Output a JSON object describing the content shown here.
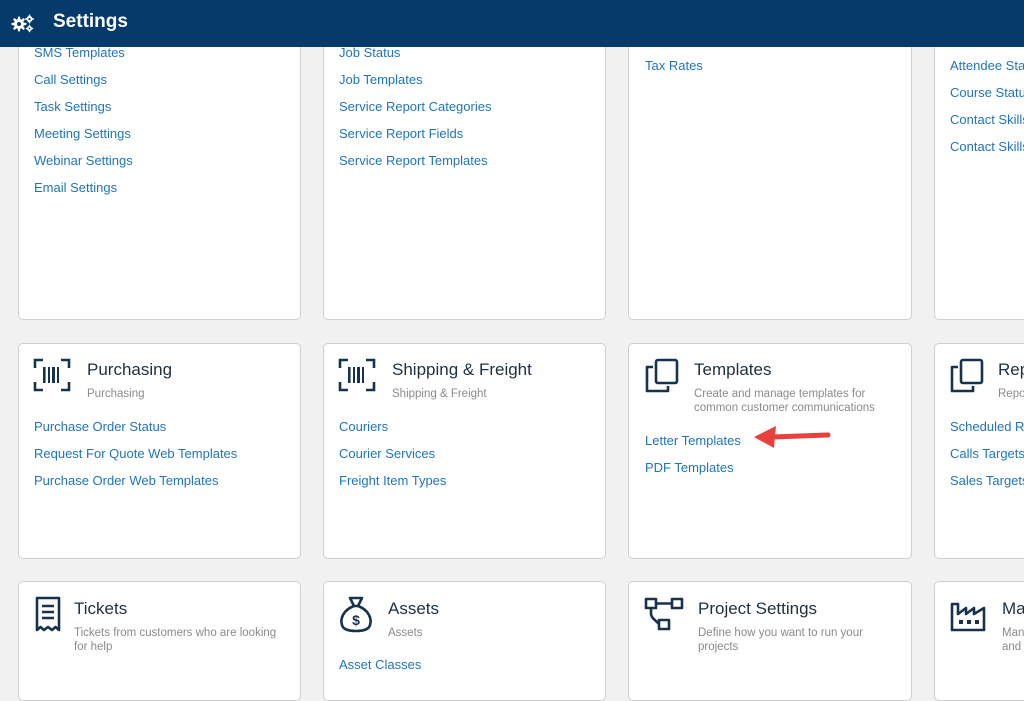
{
  "header": {
    "title": "Settings",
    "icon": "gears-icon"
  },
  "colors": {
    "header_bg": "#063a6b",
    "link": "#1f74bf",
    "arrow": "#e8413c"
  },
  "row1": {
    "col1": {
      "links": [
        "SMS Templates",
        "Call Settings",
        "Task Settings",
        "Meeting Settings",
        "Webinar Settings",
        "Email Settings"
      ]
    },
    "col2": {
      "links": [
        "Job Status",
        "Job Templates",
        "Service Report Categories",
        "Service Report Fields",
        "Service Report Templates"
      ]
    },
    "col3": {
      "links": [
        "Tax Rates"
      ]
    },
    "col4": {
      "links": [
        "Attendee Sta",
        "Course Statu",
        "Contact Skills",
        "Contact Skills"
      ]
    }
  },
  "row2": {
    "purchasing": {
      "title": "Purchasing",
      "subtitle": "Purchasing",
      "icon": "barcode-icon",
      "links": [
        "Purchase Order Status",
        "Request For Quote Web Templates",
        "Purchase Order Web Templates"
      ]
    },
    "shipping": {
      "title": "Shipping & Freight",
      "subtitle": "Shipping & Freight",
      "icon": "barcode-icon",
      "links": [
        "Couriers",
        "Courier Services",
        "Freight Item Types"
      ]
    },
    "templates": {
      "title": "Templates",
      "subtitle_line1": "Create and manage templates for",
      "subtitle_line2": "common customer communications",
      "icon": "copy-icon",
      "links": [
        "Letter Templates",
        "PDF Templates"
      ]
    },
    "reports": {
      "title": "Rep",
      "subtitle": "Repo",
      "icon": "copy-icon",
      "links": [
        "Scheduled Re",
        "Calls Targets",
        "Sales Targets"
      ]
    }
  },
  "row3": {
    "tickets": {
      "title": "Tickets",
      "subtitle_line1": "Tickets from customers who are looking",
      "subtitle_line2": "for help",
      "icon": "receipt-icon"
    },
    "assets": {
      "title": "Assets",
      "subtitle": "Assets",
      "icon": "money-bag-icon",
      "links": [
        "Asset Classes"
      ]
    },
    "project_settings": {
      "title": "Project Settings",
      "subtitle_line1": "Define how you want to run your",
      "subtitle_line2": "projects",
      "icon": "flowchart-icon"
    },
    "manufacturing": {
      "title": "Ma",
      "subtitle_line1": "Man",
      "subtitle_line2": "and",
      "icon": "factory-icon"
    }
  }
}
